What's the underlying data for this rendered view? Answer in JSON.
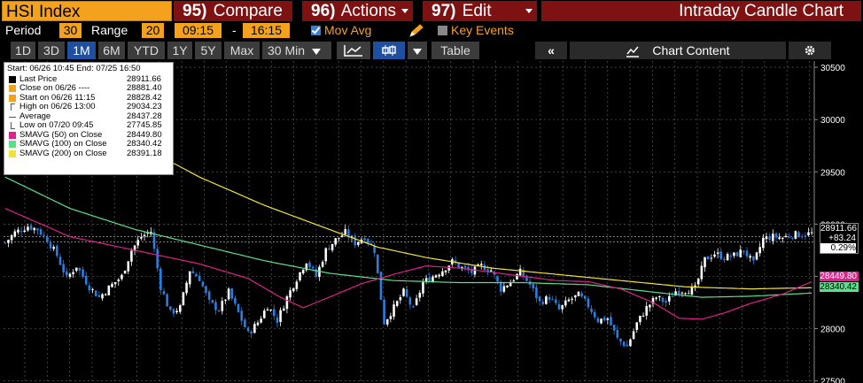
{
  "title_bar": {
    "ticker": "HSI Index",
    "menus": [
      {
        "num": "95)",
        "label": "Compare",
        "has_caret": false
      },
      {
        "num": "96)",
        "label": "Actions",
        "has_caret": true
      },
      {
        "num": "97)",
        "label": "Edit",
        "has_caret": true
      }
    ],
    "chart_title": "Intraday Candle Chart"
  },
  "controls": {
    "period_label": "Period",
    "period_value": "30",
    "range_label": "Range",
    "range_value": "20",
    "time_start": "09:15",
    "time_sep": "-",
    "time_end": "16:15",
    "mov_avg_label": "Mov Avg",
    "mov_avg_checked": true,
    "key_events_label": "Key Events",
    "key_events_checked": false
  },
  "toolbar": {
    "ranges": [
      "1D",
      "3D",
      "1M",
      "6M",
      "YTD",
      "1Y",
      "5Y",
      "Max"
    ],
    "active_range": "1M",
    "interval": "30 Min",
    "table_label": "Table",
    "collapse_label": "«",
    "chart_content_label": "Chart Content",
    "icons": [
      "line-chart-icon",
      "candle-chart-icon",
      "chevron-down-icon",
      "chart-content-icon",
      "gear-icon"
    ]
  },
  "legend": {
    "header": "Start: 06/26 10:45 End: 07/25 16:50",
    "rows": [
      {
        "name": "Last Price",
        "value": "28911.66",
        "color": "#000000",
        "sym": "square"
      },
      {
        "name": "Close on 06/26 ----",
        "value": "28881.40",
        "color": "#f4a21d",
        "sym": "square"
      },
      {
        "name": "Start on 06/26 11:15",
        "value": "28828.42",
        "color": "#f4a21d",
        "sym": "square"
      },
      {
        "name": "High on 06/26 13:00",
        "value": "29034.23",
        "color": "#888888",
        "sym": "high"
      },
      {
        "name": "Average",
        "value": "28437.28",
        "color": "#888888",
        "sym": "avg"
      },
      {
        "name": "Low on 07/20 09:45",
        "value": "27745.85",
        "color": "#888888",
        "sym": "low"
      },
      {
        "name": "SMAVG (50) on Close",
        "value": "28449.80",
        "color": "#e0208c",
        "sym": "square"
      },
      {
        "name": "SMAVG (100) on Close",
        "value": "28340.42",
        "color": "#5be08a",
        "sym": "square"
      },
      {
        "name": "SMAVG (200) on Close",
        "value": "28391.18",
        "color": "#f2e33a",
        "sym": "square"
      }
    ]
  },
  "price_tags": {
    "last": "28911.66",
    "change": "+83.24",
    "pct": "0.29%",
    "sma50": "28449.80",
    "sma100": "28340.42"
  },
  "colors": {
    "accent_orange": "#f4a21d",
    "menu_red": "#7e1212",
    "up_candle": "#ffffff",
    "down_candle": "#2b7fe0",
    "sma50": "#e0208c",
    "sma100": "#5be08a",
    "sma200": "#f2e33a"
  },
  "chart_data": {
    "type": "candlestick",
    "y_ticks": [
      27500,
      28000,
      28500,
      29000,
      29500,
      30000,
      30500
    ],
    "ylim": [
      27480,
      30560
    ],
    "x_count": 250,
    "reference_lines": [
      {
        "name": "Close on 06/26",
        "value": 28881.4
      },
      {
        "name": "Start on 06/26 11:15",
        "value": 28828.42
      }
    ],
    "close_path": [
      [
        0,
        28820
      ],
      [
        3,
        28920
      ],
      [
        7,
        28980
      ],
      [
        10,
        28950
      ],
      [
        13,
        28850
      ],
      [
        16,
        28700
      ],
      [
        19,
        28480
      ],
      [
        22,
        28600
      ],
      [
        26,
        28400
      ],
      [
        29,
        28300
      ],
      [
        33,
        28420
      ],
      [
        36,
        28500
      ],
      [
        39,
        28750
      ],
      [
        42,
        28880
      ],
      [
        45,
        28930
      ],
      [
        48,
        28400
      ],
      [
        51,
        28150
      ],
      [
        54,
        28200
      ],
      [
        57,
        28560
      ],
      [
        60,
        28480
      ],
      [
        63,
        28250
      ],
      [
        66,
        28180
      ],
      [
        69,
        28350
      ],
      [
        72,
        28150
      ],
      [
        75,
        27950
      ],
      [
        78,
        28060
      ],
      [
        81,
        28220
      ],
      [
        84,
        28080
      ],
      [
        87,
        28300
      ],
      [
        90,
        28480
      ],
      [
        93,
        28650
      ],
      [
        96,
        28500
      ],
      [
        99,
        28750
      ],
      [
        102,
        28850
      ],
      [
        105,
        28920
      ],
      [
        108,
        28820
      ],
      [
        111,
        28880
      ],
      [
        114,
        28750
      ],
      [
        117,
        28060
      ],
      [
        120,
        28200
      ],
      [
        123,
        28350
      ],
      [
        126,
        28180
      ],
      [
        129,
        28440
      ],
      [
        132,
        28500
      ],
      [
        135,
        28560
      ],
      [
        138,
        28640
      ],
      [
        141,
        28580
      ],
      [
        144,
        28540
      ],
      [
        147,
        28600
      ],
      [
        150,
        28560
      ],
      [
        153,
        28380
      ],
      [
        156,
        28450
      ],
      [
        159,
        28540
      ],
      [
        162,
        28420
      ],
      [
        165,
        28250
      ],
      [
        168,
        28300
      ],
      [
        171,
        28180
      ],
      [
        174,
        28270
      ],
      [
        177,
        28320
      ],
      [
        180,
        28220
      ],
      [
        183,
        28080
      ],
      [
        186,
        28100
      ],
      [
        189,
        27900
      ],
      [
        192,
        27830
      ],
      [
        195,
        28050
      ],
      [
        198,
        28200
      ],
      [
        201,
        28300
      ],
      [
        204,
        28250
      ],
      [
        207,
        28360
      ],
      [
        210,
        28370
      ],
      [
        213,
        28380
      ],
      [
        216,
        28660
      ],
      [
        219,
        28720
      ],
      [
        222,
        28680
      ],
      [
        225,
        28700
      ],
      [
        228,
        28750
      ],
      [
        231,
        28620
      ],
      [
        234,
        28860
      ],
      [
        237,
        28880
      ],
      [
        240,
        28870
      ],
      [
        243,
        28900
      ],
      [
        246,
        28900
      ],
      [
        249,
        28911.66
      ]
    ],
    "sma50": [
      [
        0,
        29150
      ],
      [
        20,
        28880
      ],
      [
        40,
        28750
      ],
      [
        60,
        28620
      ],
      [
        75,
        28480
      ],
      [
        85,
        28300
      ],
      [
        92,
        28200
      ],
      [
        100,
        28300
      ],
      [
        110,
        28430
      ],
      [
        120,
        28520
      ],
      [
        130,
        28600
      ],
      [
        140,
        28580
      ],
      [
        150,
        28540
      ],
      [
        160,
        28500
      ],
      [
        170,
        28460
      ],
      [
        180,
        28450
      ],
      [
        190,
        28380
      ],
      [
        200,
        28250
      ],
      [
        208,
        28100
      ],
      [
        215,
        28090
      ],
      [
        222,
        28150
      ],
      [
        230,
        28240
      ],
      [
        240,
        28330
      ],
      [
        249,
        28449.8
      ]
    ],
    "sma100": [
      [
        0,
        29450
      ],
      [
        20,
        29150
      ],
      [
        40,
        28950
      ],
      [
        60,
        28800
      ],
      [
        80,
        28650
      ],
      [
        100,
        28530
      ],
      [
        120,
        28460
      ],
      [
        140,
        28440
      ],
      [
        160,
        28440
      ],
      [
        180,
        28420
      ],
      [
        200,
        28350
      ],
      [
        215,
        28300
      ],
      [
        230,
        28310
      ],
      [
        249,
        28340.42
      ]
    ],
    "sma200": [
      [
        40,
        29780
      ],
      [
        60,
        29450
      ],
      [
        80,
        29180
      ],
      [
        100,
        28950
      ],
      [
        115,
        28780
      ],
      [
        130,
        28680
      ],
      [
        150,
        28580
      ],
      [
        170,
        28520
      ],
      [
        190,
        28460
      ],
      [
        210,
        28400
      ],
      [
        230,
        28380
      ],
      [
        249,
        28391.18
      ]
    ]
  }
}
